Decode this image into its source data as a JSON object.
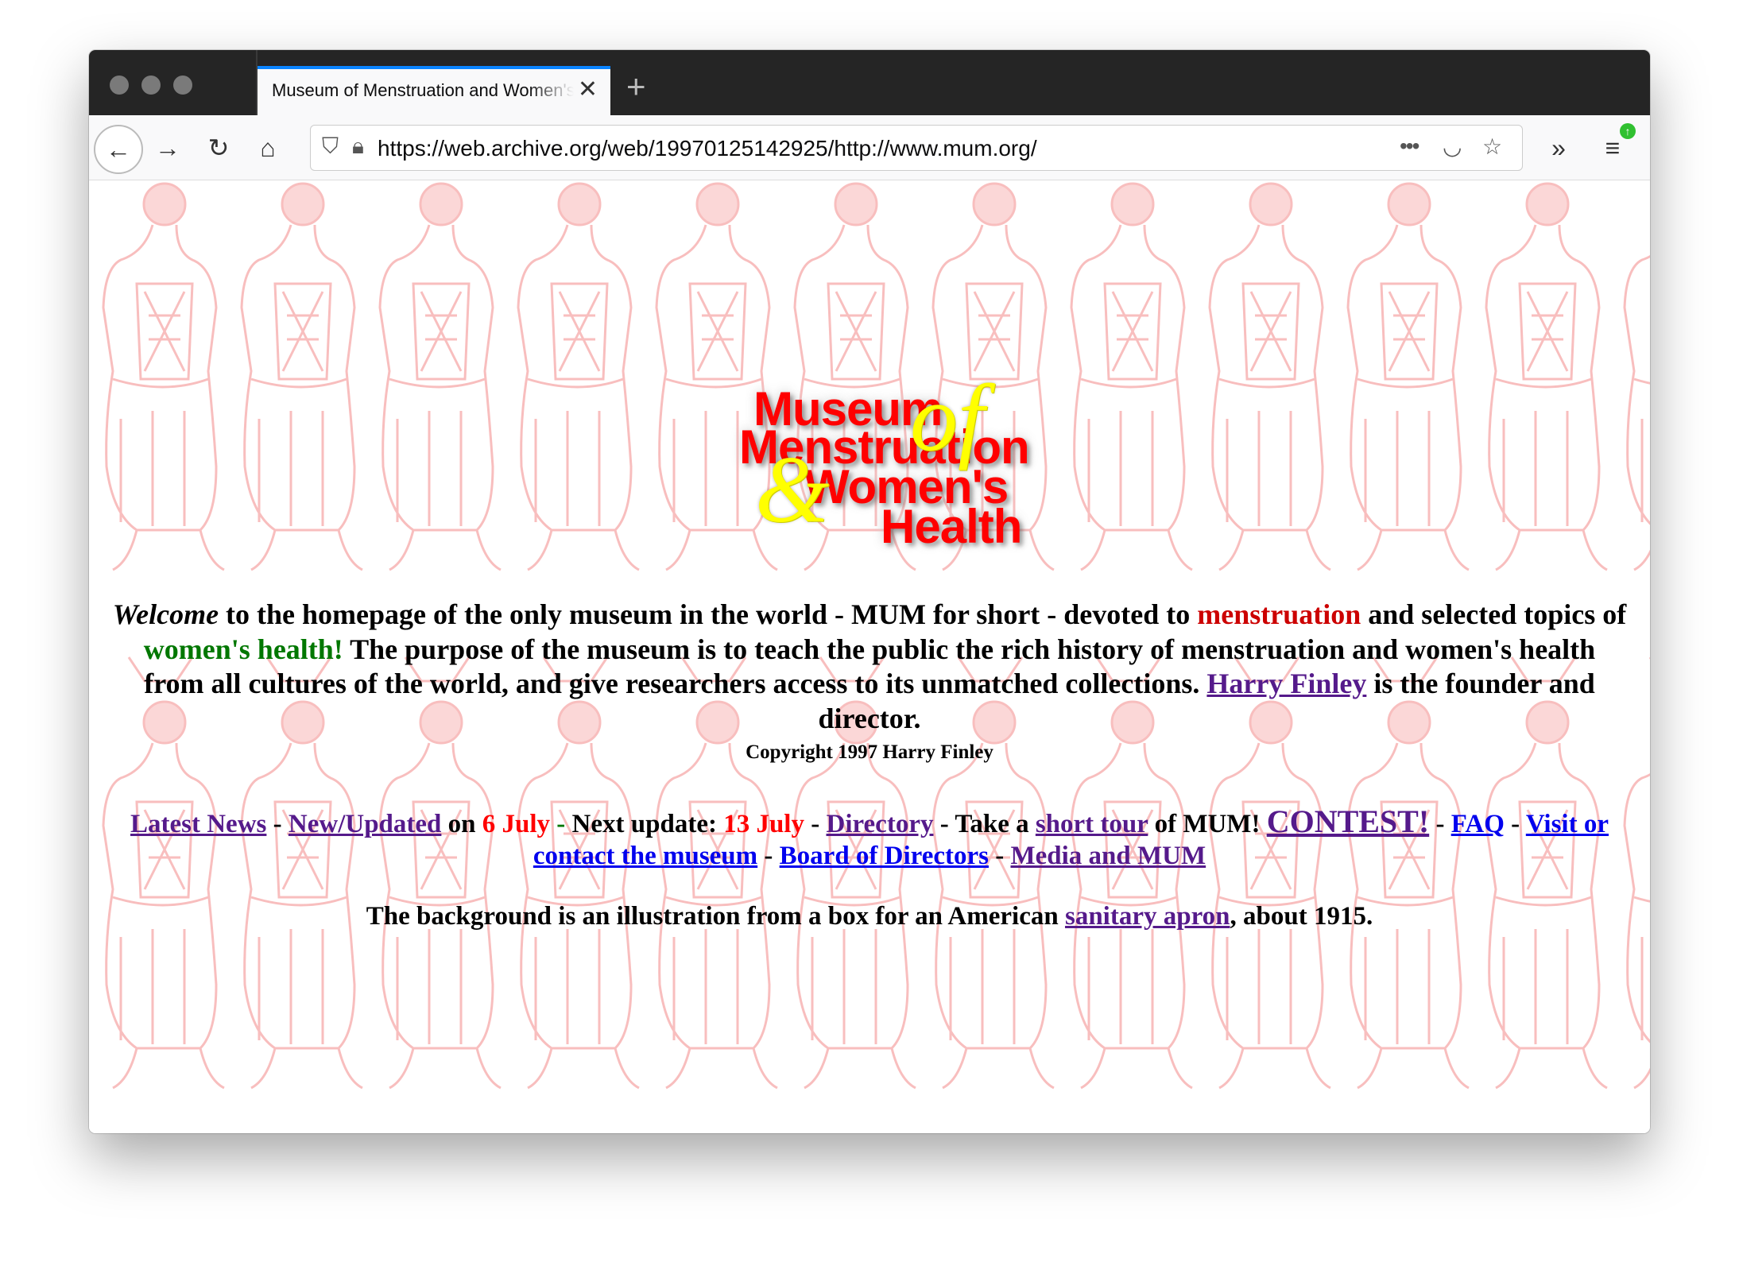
{
  "browser": {
    "tab_title": "Museum of Menstruation and Women's Health",
    "url": "https://web.archive.org/web/19970125142925/http://www.mum.org/",
    "accent": "#0a84ff"
  },
  "logo": {
    "line1": "Museum",
    "of": "of",
    "line2": "Menstruation",
    "amp": "&",
    "line3": "Women's",
    "line4": "Health"
  },
  "intro": {
    "welcome": "Welcome",
    "t1": " to the homepage of the only museum in the world - MUM for short - devoted to ",
    "menstruation": "menstruation",
    "t2": " and selected topics of ",
    "womens_health": "women's health!",
    "t3": " The purpose of the museum is to teach the public the rich history of menstruation and women's health from all cultures of the world, and give researchers access to its unmatched collections. ",
    "founder_link": "Harry Finley",
    "t4": " is the founder and director."
  },
  "copyright": "Copyright 1997 Harry Finley",
  "nav": {
    "latest_news": "Latest News",
    "sep": " - ",
    "new_updated": "New/Updated",
    "on": " on ",
    "date1": "6 July",
    "next_update": " Next update: ",
    "date2": "13 July",
    "directory": "Directory",
    "take_a": " - Take a ",
    "short_tour": "short tour",
    "of_mum": " of MUM! ",
    "contest": "CONTEST!",
    "faq": "FAQ",
    "visit": "Visit or contact the museum",
    "board": "Board of Directors",
    "media": "Media and MUM"
  },
  "bg_note": {
    "t1": "The background is an illustration from a box for an American ",
    "link": "sanitary apron",
    "t2": ", about 1915."
  },
  "colors": {
    "visited": "#551a8b",
    "link": "#0000ee",
    "pattern": "#f7b7b7"
  }
}
